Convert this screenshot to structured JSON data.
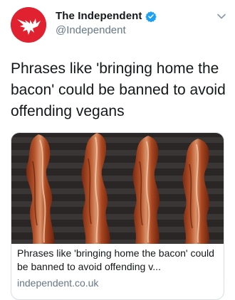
{
  "tweet": {
    "author": {
      "display_name": "The Independent",
      "handle": "@Independent",
      "verified": true,
      "avatar_icon": "eagle-logo-icon",
      "avatar_color": "#e02230"
    },
    "text": "Phrases like 'bringing home the bacon' could be banned to avoid offending vegans",
    "menu_icon": "chevron-down-icon"
  },
  "link_card": {
    "title": "Phrases like 'bringing home the bacon' could be banned to avoid offending v...",
    "domain": "independent.co.uk",
    "image_subject": "bacon-strips-on-grill"
  },
  "colors": {
    "verified_badge": "#1da1f2",
    "text_primary": "#14171a",
    "text_secondary": "#657786",
    "card_border": "#d8dee3"
  }
}
